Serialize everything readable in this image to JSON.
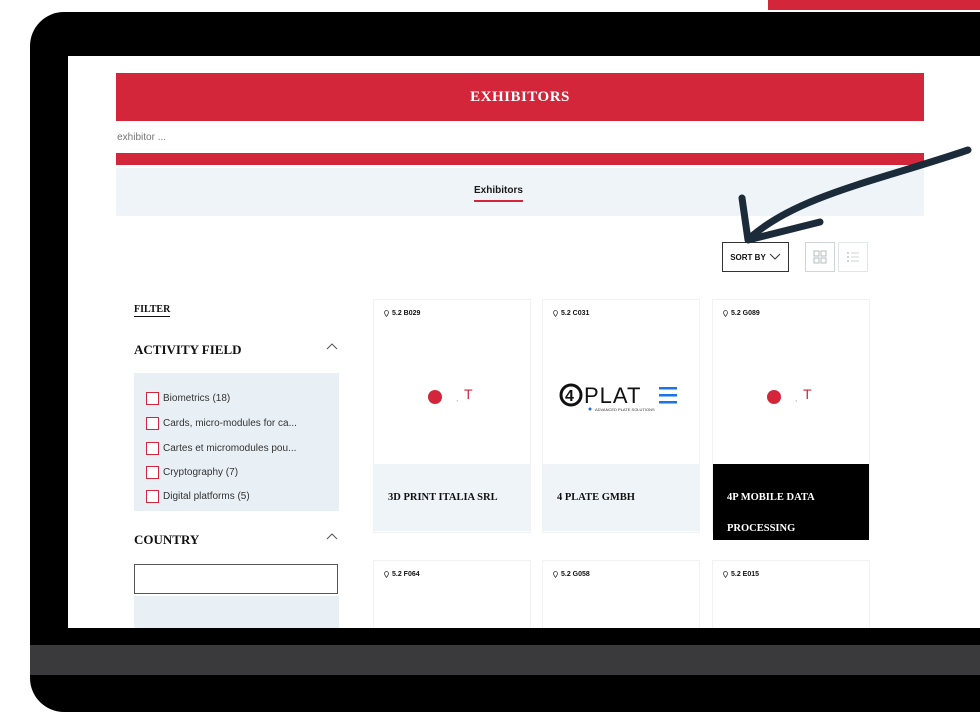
{
  "header": {
    "title": "EXHIBITORS"
  },
  "search": {
    "placeholder": "d, exhibitor ..."
  },
  "tabs": [
    {
      "label": "Exhibitors",
      "active": true
    }
  ],
  "toolbar": {
    "sort_label": "SORT BY"
  },
  "filter": {
    "title": "FILTER",
    "activity_field": {
      "title": "ACTIVITY FIELD",
      "items": [
        {
          "label": "Biometrics  (18)"
        },
        {
          "label": "Cards, micro-modules for ca..."
        },
        {
          "label": "Cartes et micromodules pou..."
        },
        {
          "label": "Cryptography  (7)"
        },
        {
          "label": "Digital platforms  (5)"
        }
      ]
    },
    "country": {
      "title": "COUNTRY"
    }
  },
  "cards": [
    {
      "location": "5.2 B029",
      "name": "3D PRINT ITALIA SRL",
      "logo": "t-dot-logo"
    },
    {
      "location": "5.2 C031",
      "name": "4 PLATE GMBH",
      "logo": "4plate-logo",
      "logo_text": "PLAT",
      "logo_sub": "ADVANCED PLATE SOLUTIONS"
    },
    {
      "location": "5.2 G089",
      "name": "4P MOBILE DATA PROCESSING",
      "logo": "t-dot-logo",
      "highlighted": true
    },
    {
      "location": "5.2 F064"
    },
    {
      "location": "5.2 G058"
    },
    {
      "location": "5.2 E015"
    }
  ],
  "logo_letter": "T",
  "colors": {
    "accent": "#d3263b",
    "bezel": "#000000",
    "panel": "#eef4f8",
    "arrow": "#1c2b3a"
  }
}
